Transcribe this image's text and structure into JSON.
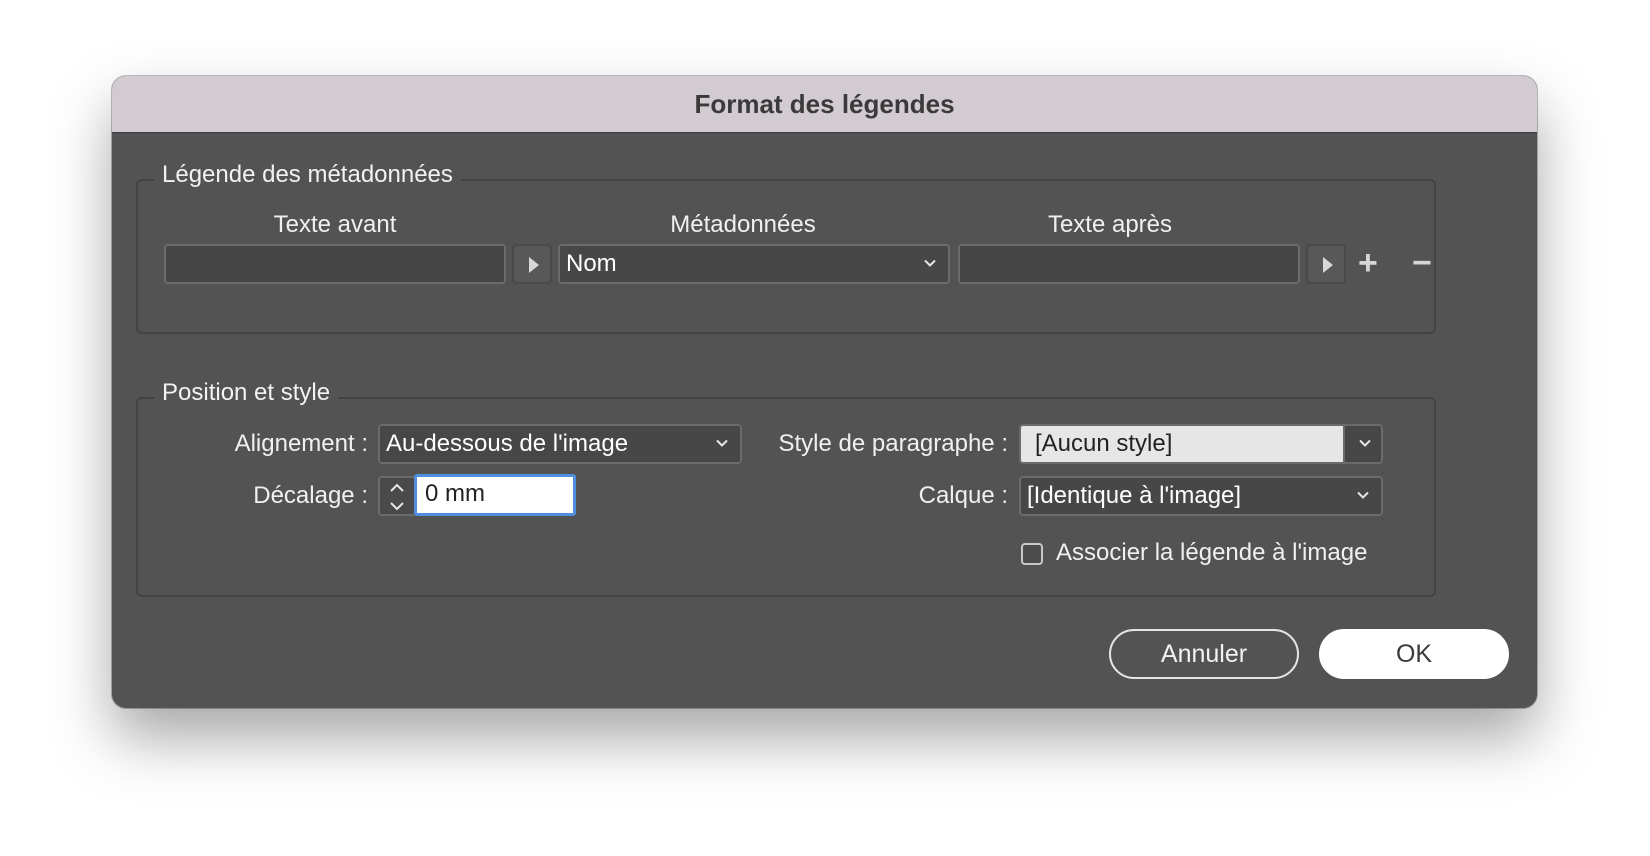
{
  "dialog": {
    "title": "Format des légendes"
  },
  "metadata_section": {
    "title": "Légende des métadonnées",
    "text_before_label": "Texte avant",
    "text_before_value": "",
    "metadata_label": "Métadonnées",
    "metadata_value": "Nom",
    "text_after_label": "Texte après",
    "text_after_value": "",
    "add_symbol": "+",
    "remove_symbol": "−"
  },
  "position_section": {
    "title": "Position et style",
    "alignment_label": "Alignement :",
    "alignment_value": "Au-dessous de l'image",
    "offset_label": "Décalage :",
    "offset_value": "0 mm",
    "paragraph_style_label": "Style de paragraphe :",
    "paragraph_style_value": "[Aucun style]",
    "layer_label": "Calque :",
    "layer_value": "[Identique à l'image]",
    "group_checkbox_label": "Associer la légende à l'image",
    "group_checkbox_checked": false
  },
  "buttons": {
    "cancel": "Annuler",
    "ok": "OK"
  },
  "colors": {
    "dialog_bg": "#535353",
    "titlebar_bg": "#d2cbd2",
    "focus_ring": "#4f8fe0"
  }
}
